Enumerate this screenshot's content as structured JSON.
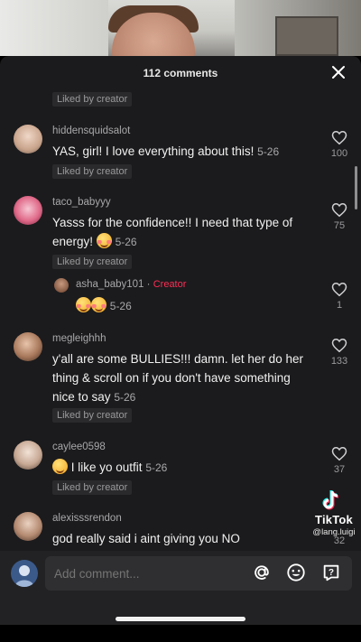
{
  "header": {
    "title": "112 comments"
  },
  "liked_by_creator_label": "Liked by creator",
  "creator_label": "Creator",
  "comments": [
    {
      "username": "hiddensquidsalot",
      "text": "YAS, girl! I love everything about this!",
      "date": "5-26",
      "likes": "100",
      "liked_by_creator": true
    },
    {
      "username": "taco_babyyy",
      "text_line1": "Yasss for the confidence!! I need that type of",
      "text_line2": "energy!",
      "date": "5-26",
      "likes": "75",
      "liked_by_creator": true
    },
    {
      "username": "asha_baby101",
      "is_creator": true,
      "date": "5-26",
      "likes": "1"
    },
    {
      "username": "megleighhh",
      "text_line1": "y'all are some BULLIES!!! damn. let her do her",
      "text_line2": "thing & scroll on if you don't have something",
      "text_line3": "nice to say",
      "date": "5-26",
      "likes": "133",
      "liked_by_creator": true
    },
    {
      "username": "caylee0598",
      "text": "I like yo outfit",
      "date": "5-26",
      "likes": "37",
      "liked_by_creator": true
    },
    {
      "username": "alexisssrendon",
      "text": "god really said i aint giving you NO",
      "likes": "32"
    }
  ],
  "input": {
    "placeholder": "Add comment..."
  },
  "watermark": {
    "brand": "TikTok",
    "handle": "@lang.luigi"
  },
  "colors": {
    "accent_creator": "#ff2d55",
    "sheet_bg": "#1b1b1d"
  }
}
